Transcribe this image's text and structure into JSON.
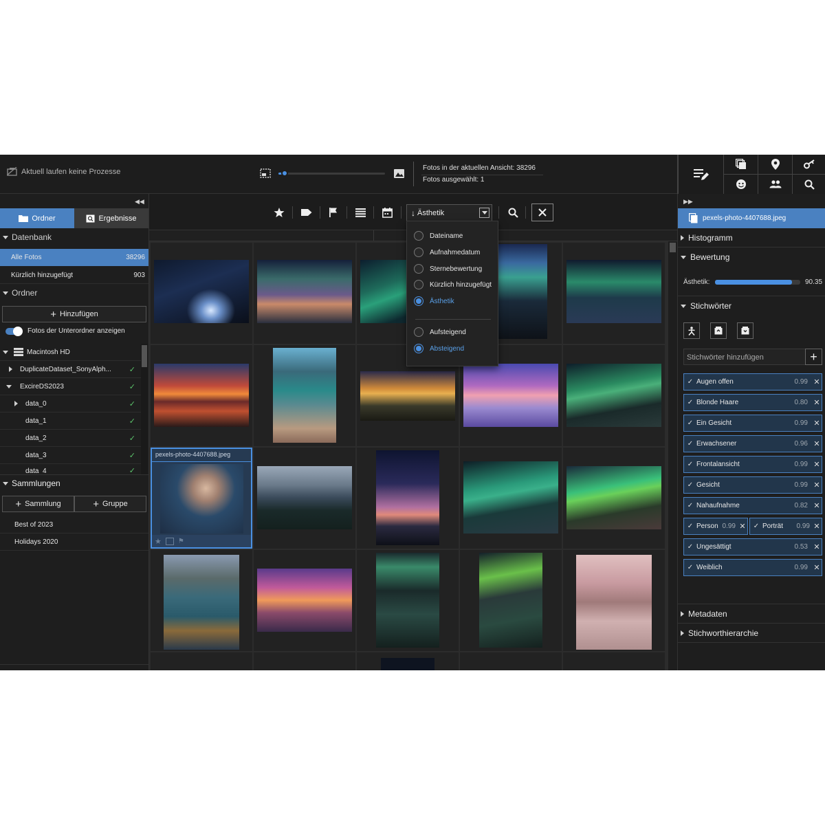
{
  "topbar": {
    "status_text": "Aktuell laufen keine Prozesse",
    "zoom_level": 0.06,
    "photos_in_view": "Fotos in der aktuellen Ansicht: 38296",
    "photos_selected": "Fotos ausgewählt: 1",
    "icons": [
      "edit-list-icon",
      "copy-stack-icon",
      "location-pin-icon",
      "key-icon",
      "face-icon",
      "people-icon",
      "search-icon"
    ]
  },
  "left": {
    "tabs": {
      "folders": "Ordner",
      "results": "Ergebnisse"
    },
    "database_header": "Datenbank",
    "database_items": [
      {
        "label": "Alle Fotos",
        "count": "38296"
      },
      {
        "label": "Kürzlich hinzugefügt",
        "count": "903"
      }
    ],
    "folders_header": "Ordner",
    "add_button": "Hinzufügen",
    "subfolders_toggle": "Fotos der Unterordner anzeigen",
    "tree": [
      {
        "label": "Macintosh HD"
      },
      {
        "label": "DuplicateDataset_SonyAlph..."
      },
      {
        "label": "ExcireDS2023"
      },
      {
        "label": "data_0"
      },
      {
        "label": "data_1"
      },
      {
        "label": "data_2"
      },
      {
        "label": "data_3"
      },
      {
        "label": "data_4"
      }
    ],
    "collections_header": "Sammlungen",
    "collection_button": "Sammlung",
    "group_button": "Gruppe",
    "collections": [
      "Best of 2023",
      "Holidays 2020"
    ]
  },
  "toolbar": {
    "sort_label": "Ästhetik",
    "icons": [
      "star-icon",
      "tag-icon",
      "flag-icon",
      "list-icon",
      "calendar-icon",
      "search-icon",
      "close-icon"
    ]
  },
  "dropdown": {
    "options": [
      "Dateiname",
      "Aufnahmedatum",
      "Sternebewertung",
      "Kürzlich hinzugefügt",
      "Ästhetik"
    ],
    "order_options": [
      "Aufsteigend",
      "Absteigend"
    ],
    "selected_option": "Ästhetik",
    "selected_order": "Absteigend"
  },
  "grid": {
    "selected_filename": "pexels-photo-4407688.jpeg"
  },
  "right": {
    "filename": "pexels-photo-4407688.jpeg",
    "histogram": "Histogramm",
    "rating": "Bewertung",
    "aesthetic_label": "Ästhetik:",
    "aesthetic_value": "90.35",
    "aesthetic_fraction": 0.9035,
    "keywords_header": "Stichwörter",
    "keywords_placeholder": "Stichwörter hinzufügen",
    "keywords": [
      {
        "label": "Augen offen",
        "score": "0.99"
      },
      {
        "label": "Blonde Haare",
        "score": "0.80"
      },
      {
        "label": "Ein Gesicht",
        "score": "0.99"
      },
      {
        "label": "Erwachsener",
        "score": "0.96"
      },
      {
        "label": "Frontalansicht",
        "score": "0.99"
      },
      {
        "label": "Gesicht",
        "score": "0.99"
      },
      {
        "label": "Nahaufnahme",
        "score": "0.82"
      },
      {
        "label": "Person",
        "score": "0.99"
      },
      {
        "label": "Porträt",
        "score": "0.99"
      },
      {
        "label": "Ungesättigt",
        "score": "0.53"
      },
      {
        "label": "Weiblich",
        "score": "0.99"
      }
    ],
    "metadata": "Metadaten",
    "hierarchy": "Stichworthierarchie"
  },
  "colors": {
    "accent": "#4a81c1",
    "accent_bright": "#4a90e2",
    "check_green": "#5cc46b",
    "panel": "#1e1e1e"
  }
}
